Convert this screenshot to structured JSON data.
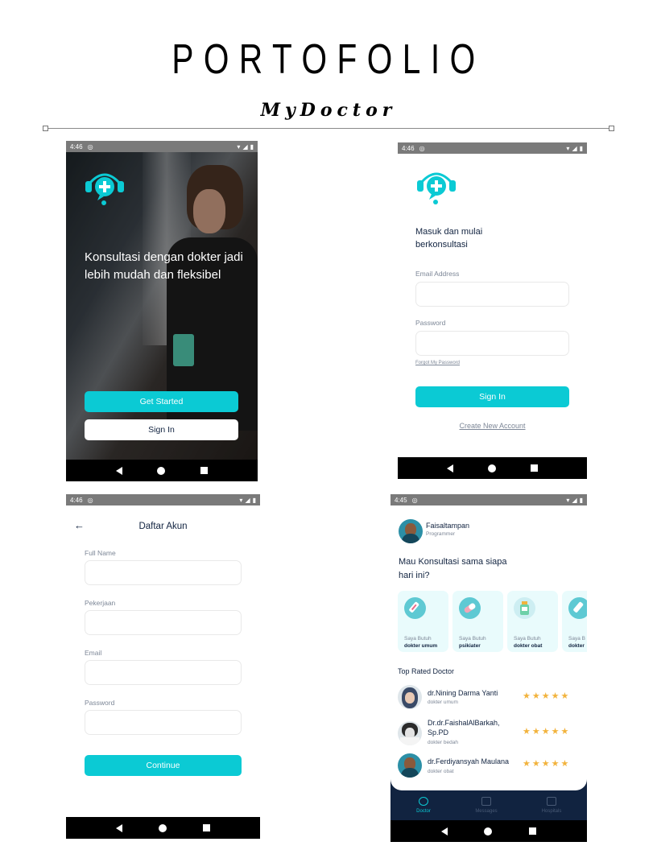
{
  "header": {
    "title": "PORTOFOLIO",
    "subtitle": "MyDoctor"
  },
  "status": {
    "time_a": "4:46",
    "time_b": "4:45"
  },
  "colors": {
    "accent": "#0bcad4",
    "dark": "#112340",
    "muted": "#7d8797",
    "star": "#f2b33d",
    "navy": "#112340"
  },
  "splash": {
    "headline": "Konsultasi dengan dokter jadi lebih mudah dan fleksibel",
    "get_started": "Get Started",
    "sign_in": "Sign In"
  },
  "login": {
    "headline": "Masuk dan mulai berkonsultasi",
    "email_label": "Email Address",
    "password_label": "Password",
    "forgot": "Forgot My Password",
    "sign_in": "Sign In",
    "create": "Create New Account"
  },
  "register": {
    "title": "Daftar Akun",
    "full_name": "Full Name",
    "job": "Pekerjaan",
    "email": "Email",
    "password": "Password",
    "continue": "Continue"
  },
  "home": {
    "user_name": "Faisaltampan",
    "user_role": "Programmer",
    "greeting": "Mau Konsultasi sama siapa hari ini?",
    "categories": [
      {
        "top": "Saya Butuh",
        "bottom": "dokter umum",
        "icon": "syringe-icon"
      },
      {
        "top": "Saya Butuh",
        "bottom": "psikiater",
        "icon": "pill-icon"
      },
      {
        "top": "Saya Butuh",
        "bottom": "dokter obat",
        "icon": "medicine-bottle-icon"
      },
      {
        "top": "Saya B",
        "bottom": "dokter",
        "icon": "syringe-icon"
      }
    ],
    "top_rated_title": "Top Rated Doctor",
    "doctors": [
      {
        "name": "dr.Nining Darma Yanti",
        "specialty": "dokter umum",
        "stars": "★★★★★"
      },
      {
        "name": "Dr.dr.FaishalAlBarkah, Sp.PD",
        "specialty": "dokter bedah",
        "stars": "★★★★★"
      },
      {
        "name": "dr.Ferdiyansyah Maulana",
        "specialty": "dokter obat",
        "stars": "★★★★★"
      }
    ],
    "tabs": [
      "Doctor",
      "Messages",
      "Hospitals"
    ]
  }
}
